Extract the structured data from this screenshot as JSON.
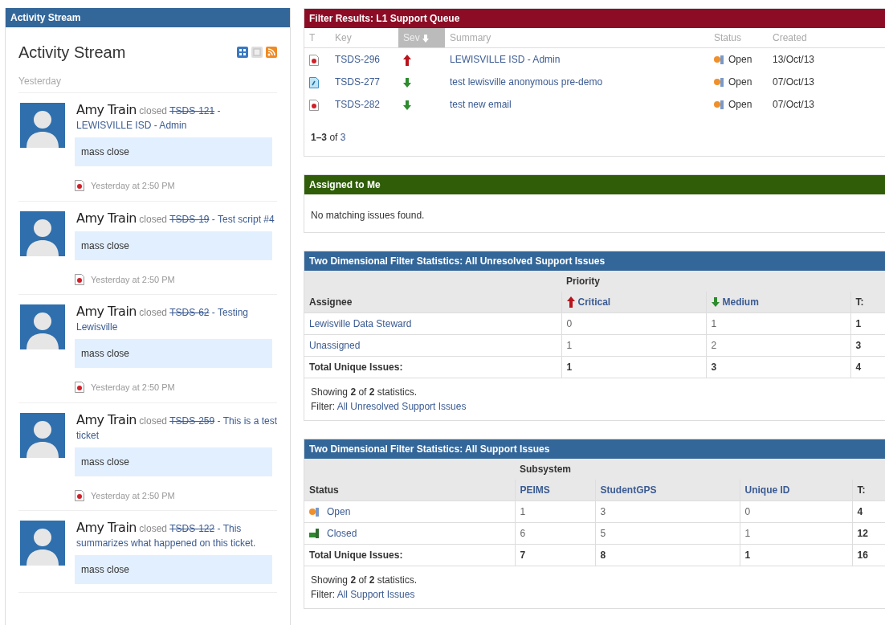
{
  "activity_stream": {
    "header": "Activity Stream",
    "title": "Activity Stream",
    "day_label": "Yesterday",
    "items": [
      {
        "user": "Amy Train",
        "action": "closed",
        "issue_key": "TSDS-121",
        "resolved": true,
        "summary": "- LEWISVILLE ISD - Admin",
        "comment": "mass close",
        "time": "Yesterday at 2:50 PM"
      },
      {
        "user": "Amy Train",
        "action": "closed",
        "issue_key": "TSDS-19",
        "resolved": true,
        "summary": "- Test script #4",
        "comment": "mass close",
        "time": "Yesterday at 2:50 PM"
      },
      {
        "user": "Amy Train",
        "action": "closed",
        "issue_key": "TSDS-62",
        "resolved": true,
        "summary": "- Testing Lewisville",
        "comment": "mass close",
        "time": "Yesterday at 2:50 PM"
      },
      {
        "user": "Amy Train",
        "action": "closed",
        "issue_key": "TSDS-259",
        "resolved": true,
        "summary": "- This is a test ticket",
        "comment": "mass close",
        "time": "Yesterday at 2:50 PM"
      },
      {
        "user": "Amy Train",
        "action": "closed",
        "issue_key": "TSDS-122",
        "resolved": true,
        "summary": "- This summarizes what happened on this ticket.",
        "comment": "mass close"
      }
    ]
  },
  "filter_results": {
    "title": "Filter Results: L1 Support Queue",
    "columns": [
      {
        "label": "T",
        "sorted": false
      },
      {
        "label": "Key",
        "sorted": false
      },
      {
        "label": "Sev",
        "sorted": true
      },
      {
        "label": "Summary",
        "sorted": false
      },
      {
        "label": "Status",
        "sorted": false
      },
      {
        "label": "Created",
        "sorted": false
      }
    ],
    "rows": [
      {
        "kind": "bug",
        "key": "TSDS-296",
        "priority": {
          "kind": "critical"
        },
        "summary": "LEWISVILLE ISD - Admin",
        "status": {
          "label": "Open",
          "kind": "open"
        },
        "created": "13/Oct/13"
      },
      {
        "kind": "task",
        "key": "TSDS-277",
        "priority": {
          "kind": "medium"
        },
        "summary": "test lewisville anonymous pre-demo",
        "status": {
          "label": "Open",
          "kind": "open"
        },
        "created": "07/Oct/13"
      },
      {
        "kind": "bug",
        "key": "TSDS-282",
        "priority": {
          "kind": "medium"
        },
        "summary": "test new email",
        "status": {
          "label": "Open",
          "kind": "open"
        },
        "created": "07/Oct/13"
      }
    ],
    "pager": {
      "range": "1–3",
      "of": "of",
      "total": "3"
    }
  },
  "assigned_to_me": {
    "title": "Assigned to Me",
    "message": "No matching issues found."
  },
  "stats": [
    {
      "title": "Two Dimensional Filter Statistics: All Unresolved Support Issues",
      "row_header": "Assignee",
      "group_header": "Priority",
      "columns": [
        {
          "label": "Critical",
          "kind": "critical"
        },
        {
          "label": "Medium",
          "kind": "medium"
        }
      ],
      "total_header": "T:",
      "rows": [
        {
          "label": "Lewisville Data Steward",
          "cells": [
            "0",
            "1"
          ],
          "total": "1"
        },
        {
          "label": "Unassigned",
          "cells": [
            "1",
            "2"
          ],
          "total": "3"
        }
      ],
      "totals_row": {
        "label": "Total Unique Issues:",
        "cells": [
          "1",
          "3"
        ],
        "total": "4"
      },
      "showing": "Showing **2** of **2** statistics.",
      "filter_label": "Filter:",
      "filter_link": "All Unresolved Support Issues"
    },
    {
      "title": "Two Dimensional Filter Statistics: All Support Issues",
      "row_header": "Status",
      "group_header": "Subsystem",
      "columns": [
        {
          "label": "PEIMS"
        },
        {
          "label": "StudentGPS"
        },
        {
          "label": "Unique ID"
        }
      ],
      "total_header": "T:",
      "rows": [
        {
          "label": "Open",
          "kind": "open",
          "cells": [
            "1",
            "3",
            "0"
          ],
          "total": "4"
        },
        {
          "label": "Closed",
          "kind": "closed",
          "cells": [
            "6",
            "5",
            "1"
          ],
          "total": "12"
        }
      ],
      "totals_row": {
        "label": "Total Unique Issues:",
        "cells": [
          "7",
          "8",
          "1"
        ],
        "total": "16"
      },
      "showing": "Showing **2** of **2** statistics.",
      "filter_label": "Filter:",
      "filter_link": "All Support Issues"
    }
  ]
}
